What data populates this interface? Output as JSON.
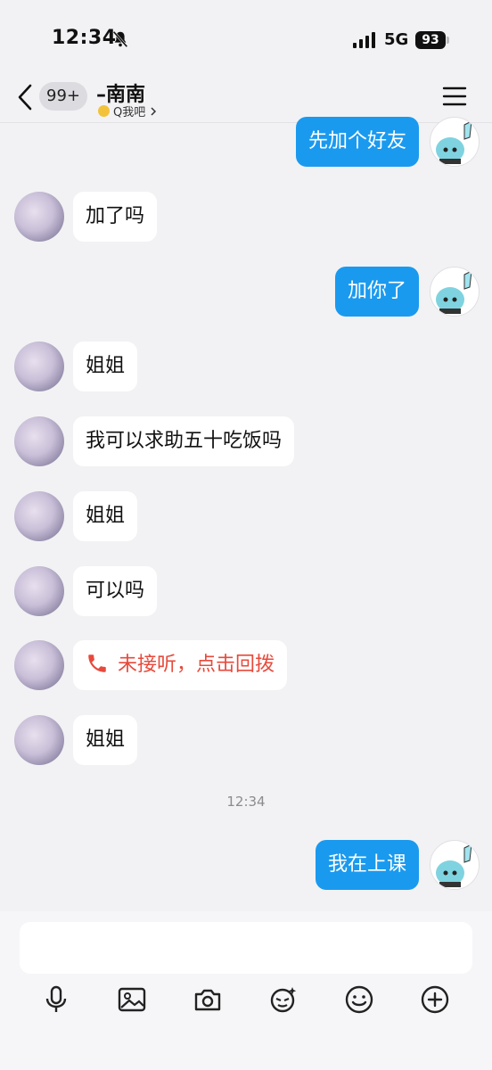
{
  "status_bar": {
    "time": "12:34",
    "network": "5G",
    "battery": "93"
  },
  "nav": {
    "back_badge": "99+",
    "title": "–南南",
    "subtitle": "Q我吧"
  },
  "messages": [
    {
      "side": "me",
      "text": "先加个好友"
    },
    {
      "side": "peer",
      "text": "加了吗"
    },
    {
      "side": "me",
      "text": "加你了"
    },
    {
      "side": "peer",
      "text": "姐姐"
    },
    {
      "side": "peer",
      "text": "我可以求助五十吃饭吗"
    },
    {
      "side": "peer",
      "text": "姐姐"
    },
    {
      "side": "peer",
      "text": "可以吗"
    },
    {
      "side": "peer",
      "type": "missed-call",
      "text": "未接听，点击回拨"
    },
    {
      "side": "peer",
      "text": "姐姐"
    },
    {
      "type": "time",
      "text": "12:34"
    },
    {
      "side": "me",
      "text": "我在上课"
    }
  ],
  "toolbar": {
    "icons": [
      "microphone-icon",
      "image-icon",
      "camera-icon",
      "sticker-icon",
      "emoji-icon",
      "plus-icon"
    ]
  },
  "colors": {
    "me_bubble": "#1a9aef",
    "peer_bubble": "#ffffff",
    "missed_call": "#e74a3b",
    "background": "#f2f2f4"
  }
}
